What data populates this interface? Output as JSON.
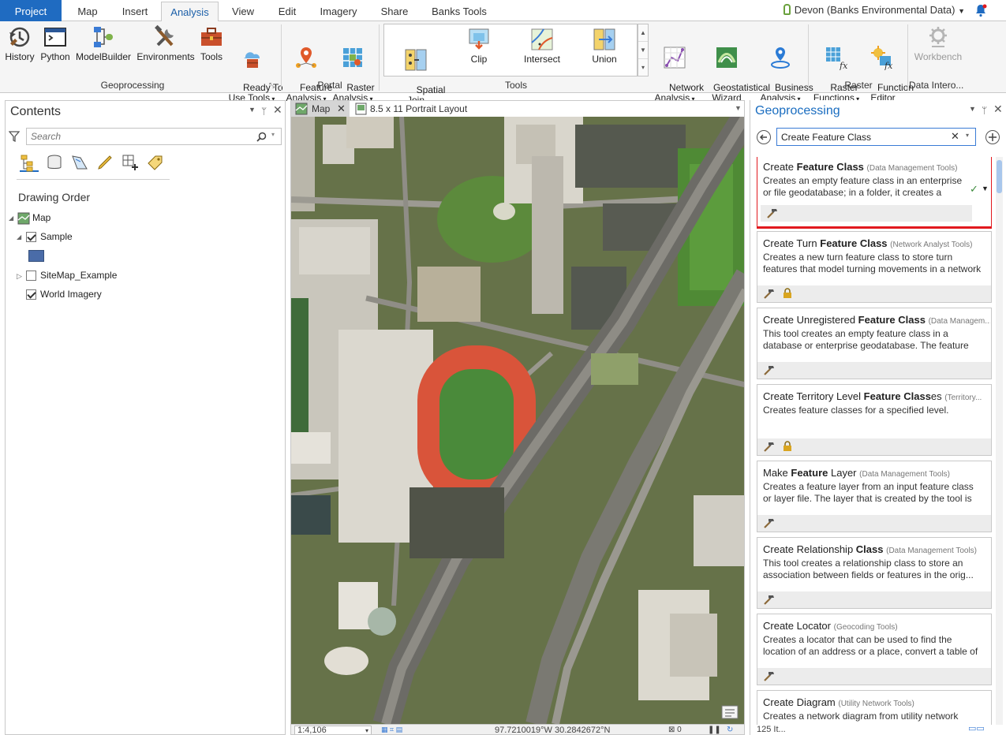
{
  "tabs": [
    "Project",
    "Map",
    "Insert",
    "Analysis",
    "View",
    "Edit",
    "Imagery",
    "Share",
    "Banks Tools"
  ],
  "user": "Devon (Banks Environmental Data)",
  "ribbon": {
    "geoprocessing": [
      "History",
      "Python",
      "ModelBuilder",
      "Environments",
      "Tools",
      "Ready To\nUse Tools"
    ],
    "portal": [
      "Feature\nAnalysis",
      "Raster\nAnalysis"
    ],
    "tools": [
      "Spatial\nJoin",
      "Clip",
      "Intersect",
      "Union"
    ],
    "other": [
      "Network\nAnalysis",
      "Geostatistical\nWizard",
      "Business\nAnalysis"
    ],
    "raster": [
      "Raster\nFunctions",
      "Function\nEditor"
    ],
    "workbench": "Workbench",
    "groups": [
      "Geoprocessing",
      "Portal",
      "Tools",
      "Raster",
      "Data Intero..."
    ]
  },
  "contents": {
    "title": "Contents",
    "search_placeholder": "Search",
    "drawing_order": "Drawing Order",
    "map": "Map",
    "layers": [
      "Sample",
      "SiteMap_Example",
      "World Imagery"
    ],
    "checked": [
      true,
      false,
      true
    ],
    "swatch_color": "#4a6ca8"
  },
  "map_tabs": [
    "Map",
    "8.5 x 11 Portrait Layout"
  ],
  "map_status": {
    "scale": "1:4,106",
    "coords": "97.7210019°W 30.2842672°N"
  },
  "gp": {
    "title": "Geoprocessing",
    "search_value": "Create Feature Class",
    "results": [
      {
        "pre": "Create ",
        "bold": "Feature Class",
        "post": "",
        "toolbox": "(Data Management Tools)",
        "desc": "Creates an empty feature class in an enterprise or file geodatabase; in a folder, it creates a shapefile",
        "lock": false
      },
      {
        "pre": "Create Turn ",
        "bold": "Feature Class",
        "post": "",
        "toolbox": "(Network Analyst Tools)",
        "desc": "Creates a new turn feature class to store turn features that model turning movements in a network dataset.",
        "lock": true
      },
      {
        "pre": "Create Unregistered ",
        "bold": "Feature Class",
        "post": "",
        "toolbox": "(Data Managem...",
        "desc": "This tool creates an empty feature class in a database or enterprise geodatabase. The feature class is not r...",
        "lock": false
      },
      {
        "pre": "Create Territory Level ",
        "bold": "Feature Class",
        "post": "es",
        "toolbox": "(Territory...",
        "desc": "Creates feature classes for a specified level.",
        "lock": true
      },
      {
        "pre": "Make ",
        "bold": "Feature",
        "post": " Layer",
        "toolbox": "(Data Management Tools)",
        "desc": "Creates a feature layer from an input feature class or layer file. The layer that is created by the tool is te...",
        "lock": false
      },
      {
        "pre": "Create Relationship ",
        "bold": "Class",
        "post": "",
        "toolbox": "(Data Management Tools)",
        "desc": "This tool creates a relationship class to store an association between fields or features in the orig...",
        "lock": false
      },
      {
        "pre": "Create Locator ",
        "bold": "",
        "post": "",
        "toolbox": "(Geocoding Tools)",
        "desc": "Creates a locator that can be used to find the location of an address or a place, convert a table of addresse...",
        "lock": false
      },
      {
        "pre": "Create Diagram ",
        "bold": "",
        "post": "",
        "toolbox": "(Utility Network Tools)",
        "desc": "Creates a network diagram from utility network",
        "lock": false
      }
    ],
    "count": "125 It..."
  },
  "colors": {
    "accent": "#1f6bc1",
    "highlight": "#e1191e",
    "track": "#d9543a",
    "field": "#4a8a3a"
  }
}
